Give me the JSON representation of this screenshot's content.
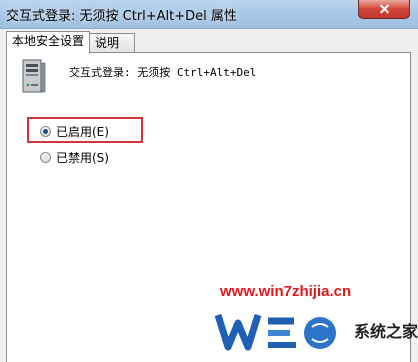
{
  "window": {
    "title": "交互式登录: 无须按 Ctrl+Alt+Del 属性"
  },
  "tabs": [
    {
      "label": "本地安全设置",
      "active": true
    },
    {
      "label": "说明",
      "active": false
    }
  ],
  "policy": {
    "name": "交互式登录: 无须按 Ctrl+Alt+Del",
    "icon": "server-icon"
  },
  "options": [
    {
      "label": "已启用(E)",
      "selected": true
    },
    {
      "label": "已禁用(S)",
      "selected": false
    }
  ],
  "watermark": {
    "url": "www.win7zhijia.cn",
    "text": "系统之家"
  },
  "colors": {
    "highlight_border": "#d9333a",
    "watermark_red": "#e4161b"
  }
}
